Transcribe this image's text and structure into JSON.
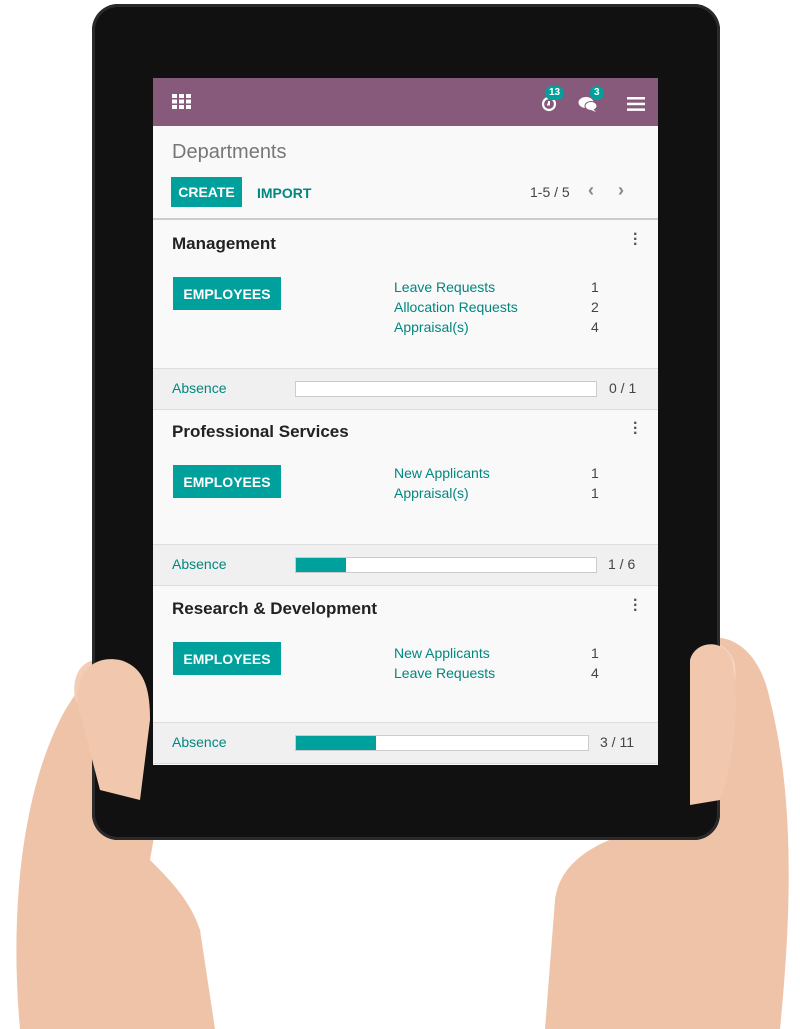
{
  "colors": {
    "navbar": "#875A7B",
    "accent": "#00A09D"
  },
  "navbar": {
    "apps_icon": "grid-icon",
    "activity_icon": "clock-icon",
    "activity_count": "13",
    "messages_icon": "chat-icon",
    "messages_count": "3",
    "menu_icon": "hamburger-icon"
  },
  "header": {
    "title": "Departments",
    "create_label": "CREATE",
    "import_label": "IMPORT",
    "pager": "1-5 / 5"
  },
  "cards": [
    {
      "name": "Management",
      "button": "EMPLOYEES",
      "stats": [
        {
          "label": "Leave Requests",
          "value": "1"
        },
        {
          "label": "Allocation Requests",
          "value": "2"
        },
        {
          "label": "Appraisal(s)",
          "value": "4"
        }
      ],
      "absence_label": "Absence",
      "absence_text": "0 / 1",
      "absence_fraction": 0
    },
    {
      "name": "Professional Services",
      "button": "EMPLOYEES",
      "stats": [
        {
          "label": "New Applicants",
          "value": "1"
        },
        {
          "label": "Appraisal(s)",
          "value": "1"
        }
      ],
      "absence_label": "Absence",
      "absence_text": "1 / 6",
      "absence_fraction": 0.1667
    },
    {
      "name": "Research & Development",
      "button": "EMPLOYEES",
      "stats": [
        {
          "label": "New Applicants",
          "value": "1"
        },
        {
          "label": "Leave Requests",
          "value": "4"
        }
      ],
      "absence_label": "Absence",
      "absence_text": "3 / 11",
      "absence_fraction": 0.2727
    }
  ]
}
